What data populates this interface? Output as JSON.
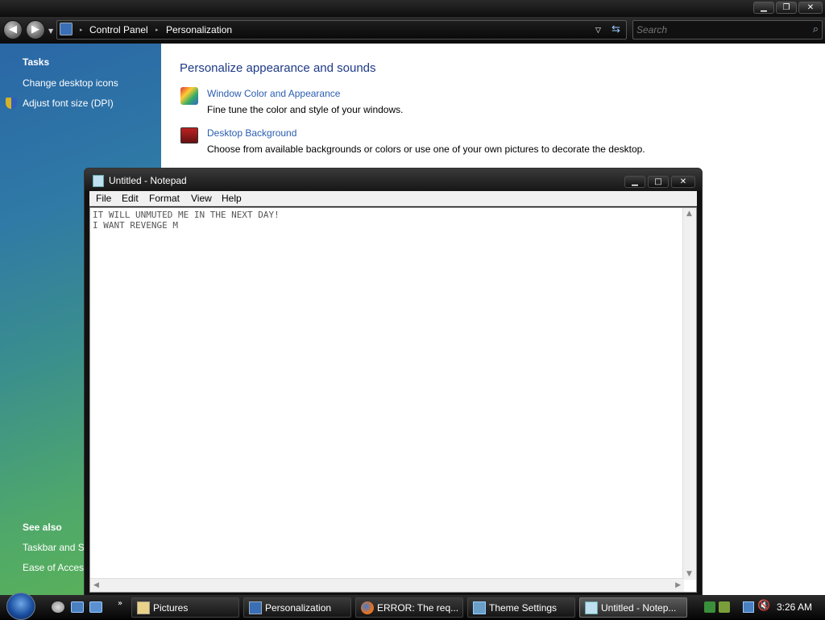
{
  "explorer": {
    "title_buttons": {
      "minimize": "▁",
      "restore": "❐",
      "close": "✕"
    },
    "nav": {
      "back": "◀",
      "forward": "▶"
    },
    "breadcrumb": [
      "Control Panel",
      "Personalization"
    ],
    "search_placeholder": "Search"
  },
  "sidebar": {
    "tasks_heading": "Tasks",
    "tasks": [
      "Change desktop icons",
      "Adjust font size (DPI)"
    ],
    "see_also_heading": "See also",
    "see_also": [
      "Taskbar and St",
      "Ease of Access"
    ]
  },
  "main": {
    "heading": "Personalize appearance and sounds",
    "items": [
      {
        "title": "Window Color and Appearance",
        "desc": "Fine tune the color and style of your windows."
      },
      {
        "title": "Desktop Background",
        "desc": "Choose from available backgrounds or colors or use one of your own pictures to decorate the desktop."
      }
    ]
  },
  "notepad": {
    "title": "Untitled - Notepad",
    "menu": [
      "File",
      "Edit",
      "Format",
      "View",
      "Help"
    ],
    "text": "IT WILL UNMUTED ME IN THE NEXT DAY!\nI WANT REVENGE M"
  },
  "taskbar": {
    "buttons": [
      "Pictures",
      "Personalization",
      "ERROR: The req...",
      "Theme Settings",
      "Untitled - Notep..."
    ],
    "active_index": 4,
    "clock": "3:26 AM"
  },
  "colors": {
    "link": "#2a5db0",
    "heading": "#1e3a86",
    "chrome": "#111111"
  }
}
